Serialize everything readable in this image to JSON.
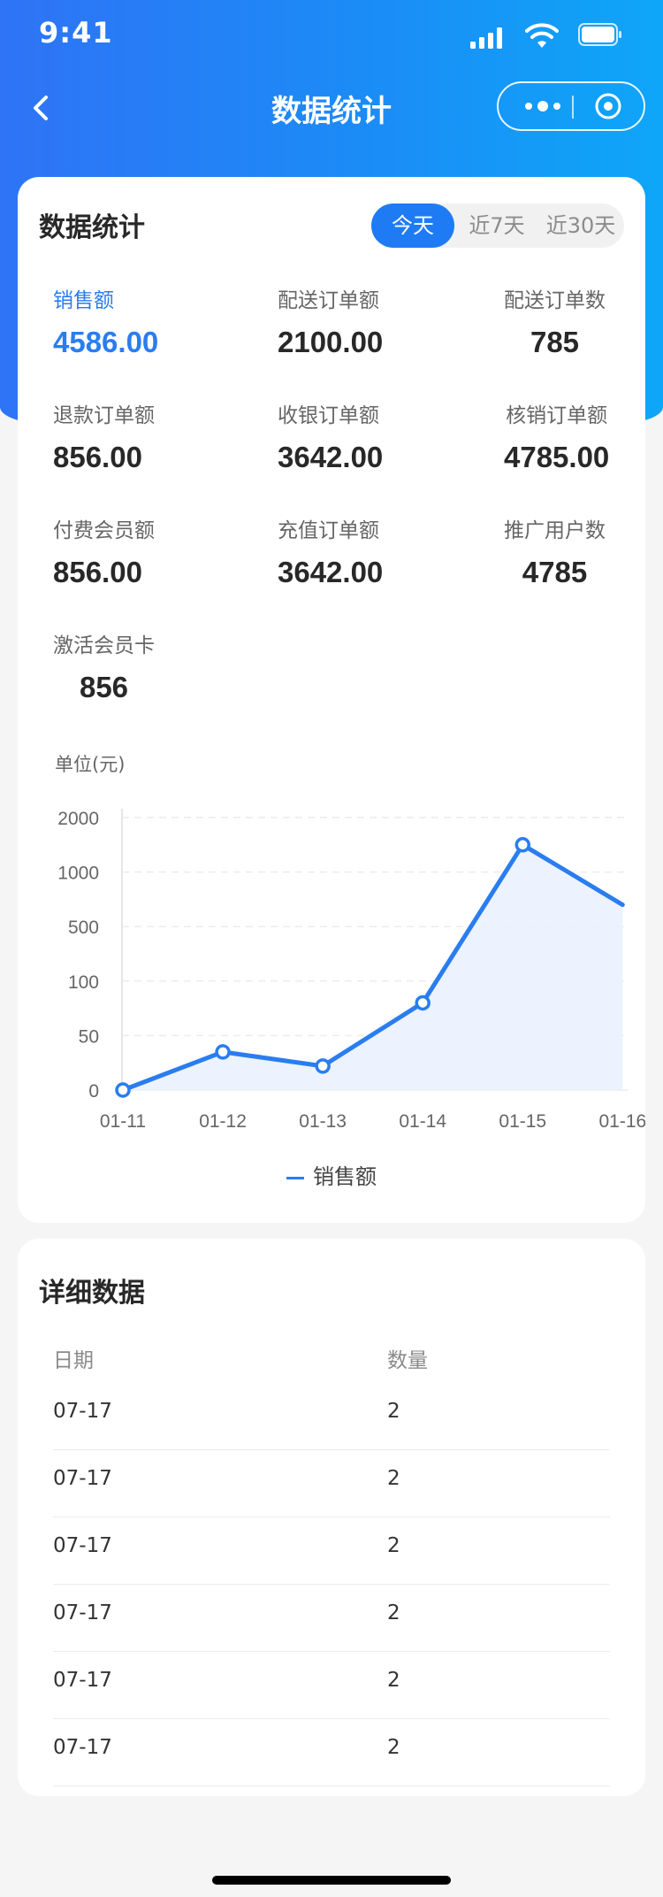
{
  "status_bar": {
    "time": "9:41"
  },
  "nav": {
    "title": "数据统计"
  },
  "stats_card": {
    "title": "数据统计",
    "tabs": [
      {
        "label": "今天",
        "active": true
      },
      {
        "label": "近7天",
        "active": false
      },
      {
        "label": "近30天",
        "active": false
      }
    ],
    "stats": [
      {
        "label": "销售额",
        "value": "4586.00",
        "highlight": true
      },
      {
        "label": "配送订单额",
        "value": "2100.00"
      },
      {
        "label": "配送订单数",
        "value": "785"
      },
      {
        "label": "退款订单额",
        "value": "856.00"
      },
      {
        "label": "收银订单额",
        "value": "3642.00"
      },
      {
        "label": "核销订单额",
        "value": "4785.00"
      },
      {
        "label": "付费会员额",
        "value": "856.00"
      },
      {
        "label": "充值订单额",
        "value": "3642.00"
      },
      {
        "label": "推广用户数",
        "value": "4785"
      },
      {
        "label": "激活会员卡",
        "value": "856"
      }
    ]
  },
  "chart": {
    "unit_label": "单位(元)",
    "legend": "销售额"
  },
  "chart_data": {
    "type": "line",
    "x": [
      "01-11",
      "01-12",
      "01-13",
      "01-14",
      "01-15",
      "01-16"
    ],
    "y_ticks": [
      "0",
      "50",
      "100",
      "500",
      "1000",
      "2000"
    ],
    "series": [
      {
        "name": "销售额",
        "values": [
          0,
          35,
          22,
          80,
          1500,
          700
        ]
      }
    ],
    "ylabel": "单位(元)",
    "grid": true,
    "area_fill": true,
    "color": "#2a7df0"
  },
  "detail": {
    "title": "详细数据",
    "columns": [
      "日期",
      "数量"
    ],
    "rows": [
      {
        "date": "07-17",
        "count": "2"
      },
      {
        "date": "07-17",
        "count": "2"
      },
      {
        "date": "07-17",
        "count": "2"
      },
      {
        "date": "07-17",
        "count": "2"
      },
      {
        "date": "07-17",
        "count": "2"
      },
      {
        "date": "07-17",
        "count": "2"
      }
    ]
  },
  "colors": {
    "primary": "#2a7df0",
    "header_start": "#2f73f6",
    "header_end": "#0ea6f8"
  }
}
